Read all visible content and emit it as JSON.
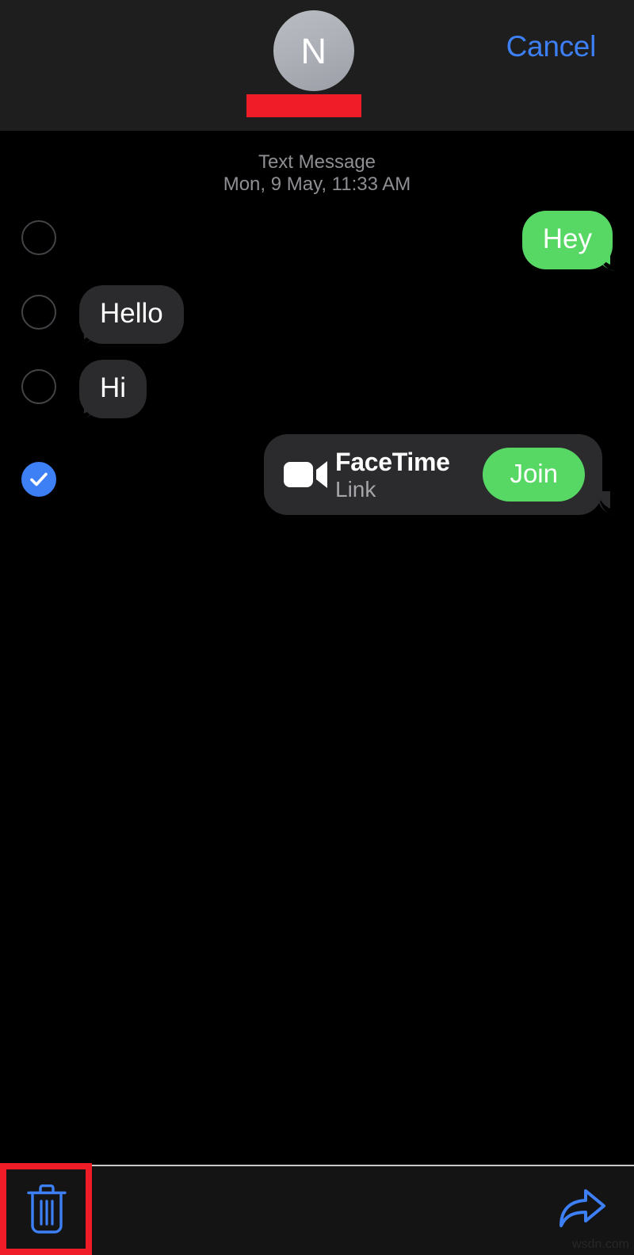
{
  "header": {
    "avatar_letter": "N",
    "avatar_name": "avatar",
    "redaction_label": "",
    "cancel_label": "Cancel"
  },
  "conversation": {
    "timestamp_service": "Text Message",
    "timestamp_date": "Mon, 9 May, 11:33 AM",
    "messages": [
      {
        "text": "Hey",
        "direction": "outgoing",
        "selected": false
      },
      {
        "text": "Hello",
        "direction": "incoming",
        "selected": false
      },
      {
        "text": "Hi",
        "direction": "incoming",
        "selected": false
      }
    ],
    "facetime": {
      "title": "FaceTime",
      "subtitle": "Link",
      "join_label": "Join",
      "icon": "video-camera-icon",
      "selected": true
    }
  },
  "toolbar": {
    "delete_icon": "trash-icon",
    "forward_icon": "forward-arrow-icon"
  },
  "watermark": {
    "text": "wsdn.com"
  },
  "colors": {
    "accent_blue": "#3d7ff5",
    "bubble_green": "#57d764",
    "bubble_gray": "#2b2b2d",
    "header_bg": "#1e1e1e",
    "annotation_red": "#f01d28",
    "screen_bg": "#000000"
  }
}
